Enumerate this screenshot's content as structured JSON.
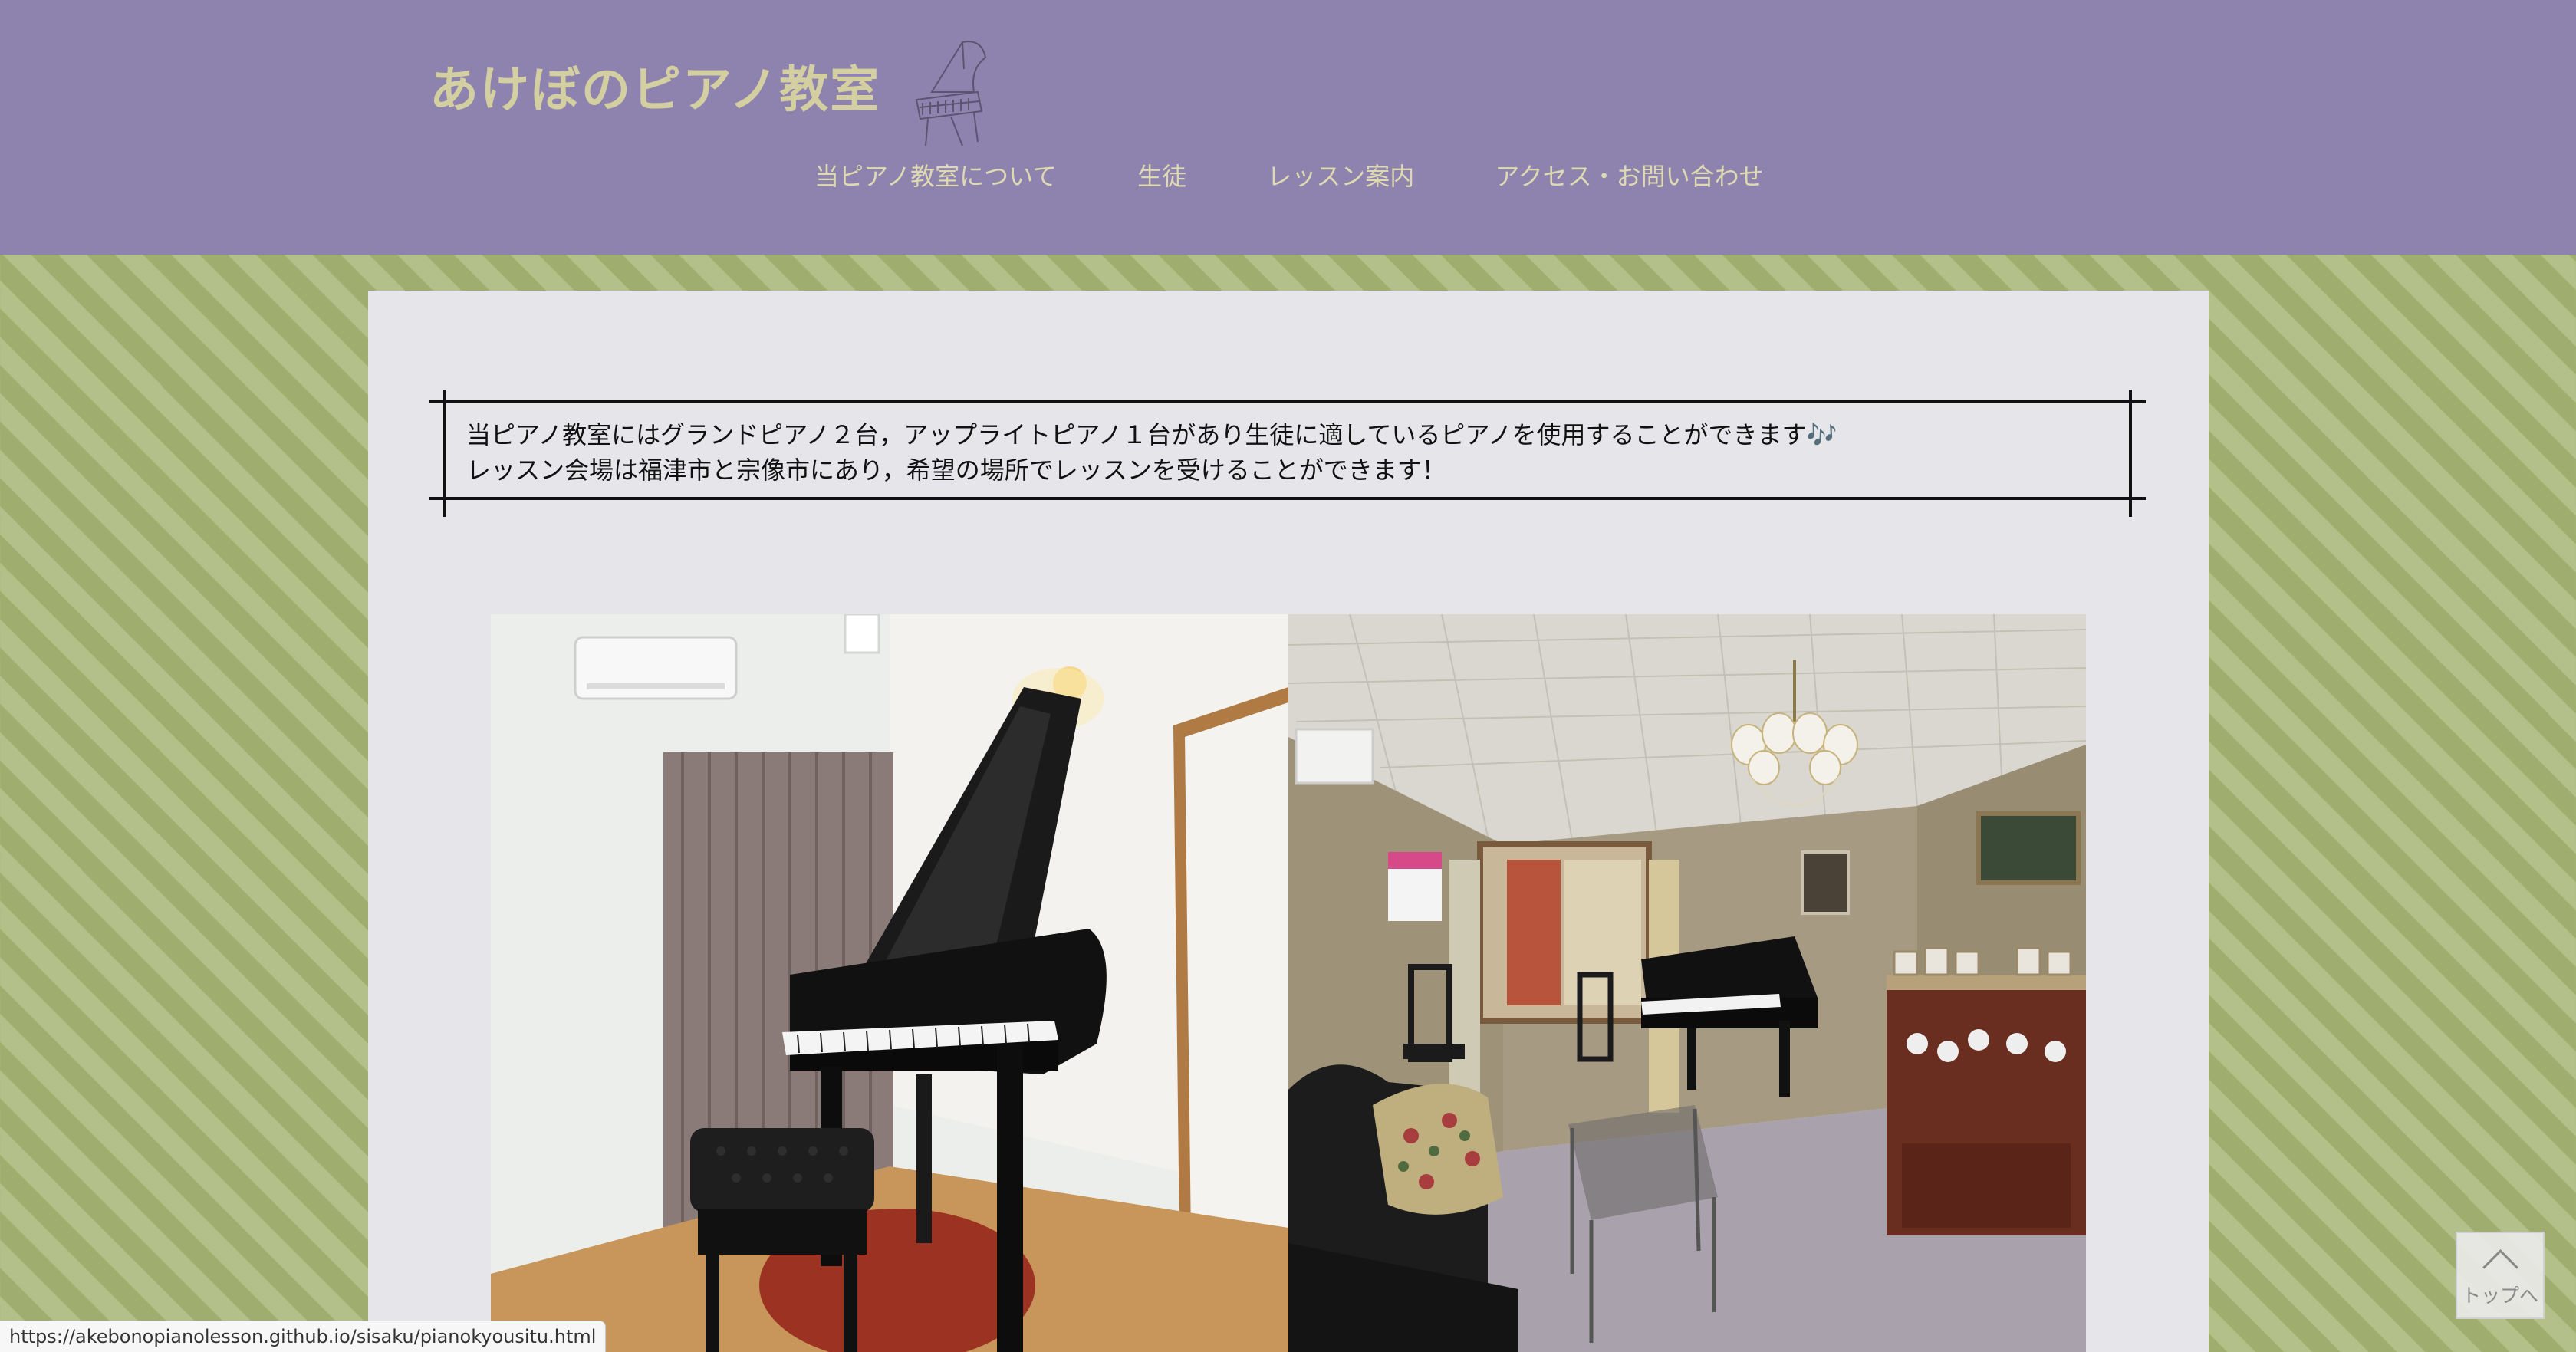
{
  "header": {
    "title": "あけぼのピアノ教室",
    "logo_icon": "grand-piano-sketch-icon",
    "nav": [
      {
        "label": "当ピアノ教室について"
      },
      {
        "label": "生徒"
      },
      {
        "label": "レッスン案内"
      },
      {
        "label": "アクセス・お問い合わせ"
      }
    ],
    "colors": {
      "background": "#8e83ae",
      "text": "#d4cfa0"
    }
  },
  "main": {
    "intro_lines": [
      "当ピアノ教室にはグランドピアノ２台，アップライトピアノ１台があり生徒に適しているピアノを使用することができます🎶",
      "レッスン会場は福津市と宗像市にあり，希望の場所でレッスンを受けることができます！"
    ],
    "photos": [
      {
        "icon": "grand-piano-room-photo"
      },
      {
        "icon": "living-room-piano-photo"
      }
    ]
  },
  "back_to_top": {
    "label": "トップへ",
    "icon": "chevron-up-icon"
  },
  "status_bar": {
    "url": "https://akebonopianolesson.github.io/sisaku/pianokyousitu.html"
  },
  "theme": {
    "page_background": "#9fae6e",
    "stripe_color": "#b3c08a",
    "card_background": "#e6e5ea"
  }
}
